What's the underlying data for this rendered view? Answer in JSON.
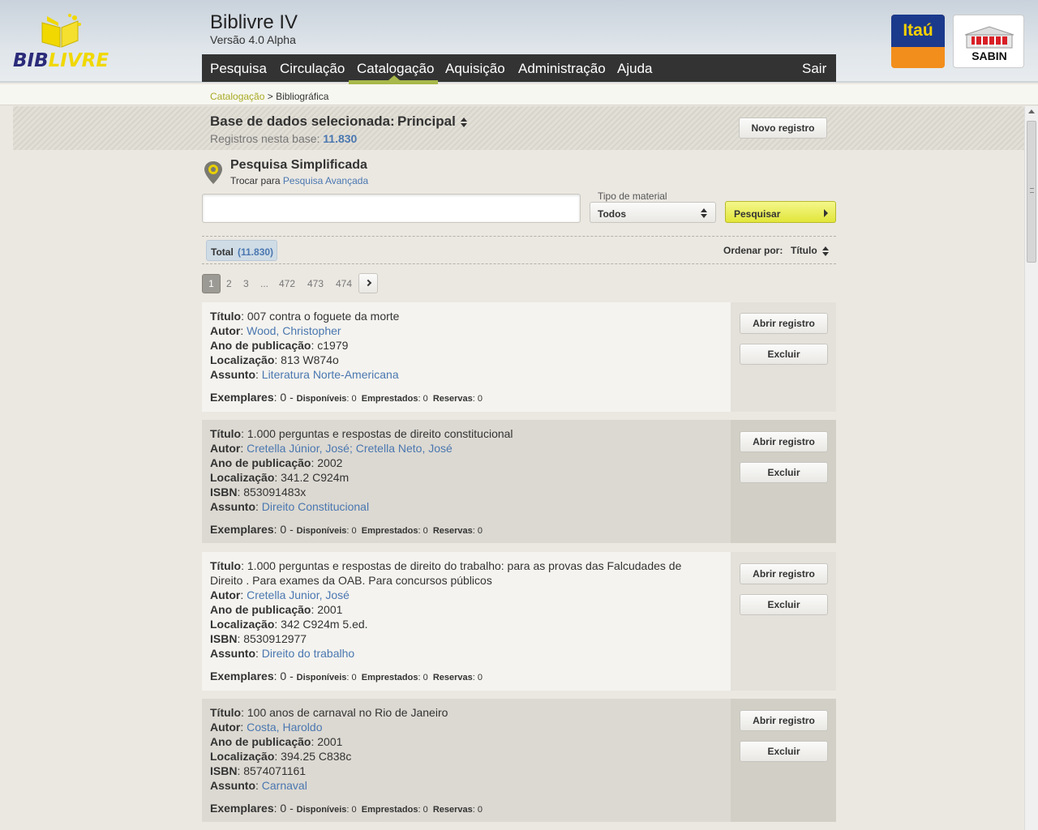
{
  "app": {
    "title": "Biblivre IV",
    "version": "Versão 4.0 Alpha",
    "logo_text_a": "BIB",
    "logo_text_b": "LIVRE"
  },
  "nav": {
    "items": [
      {
        "label": "Pesquisa"
      },
      {
        "label": "Circulação"
      },
      {
        "label": "Catalogação",
        "active": true
      },
      {
        "label": "Aquisição"
      },
      {
        "label": "Administração"
      },
      {
        "label": "Ajuda"
      }
    ],
    "logout": "Sair",
    "accent": "#a8b84a"
  },
  "sponsors": {
    "itau": "Itaú",
    "sabin": "SABIN"
  },
  "breadcrumb": {
    "parent": "Catalogação",
    "separator": " > ",
    "current": "Bibliográfica"
  },
  "database": {
    "label": "Base de dados selecionada:",
    "selected": "Principal",
    "count_label": "Registros nesta base:",
    "count": "11.830",
    "new_record": "Novo registro"
  },
  "search": {
    "title": "Pesquisa Simplificada",
    "switch_prefix": "Trocar para",
    "switch_link": "Pesquisa Avançada",
    "input_value": "",
    "material_label": "Tipo de material",
    "material_value": "Todos",
    "submit": "Pesquisar",
    "submit_color": "#e6ea44"
  },
  "results": {
    "total_label": "Total",
    "total_count": "(11.830)",
    "order_label": "Ordenar por:",
    "order_value": "Título"
  },
  "pagination": {
    "current": "1",
    "pages": [
      "2",
      "3",
      "...",
      "472",
      "473",
      "474"
    ]
  },
  "record_labels": {
    "titulo": "Título",
    "autor": "Autor",
    "ano": "Ano de publicação",
    "localizacao": "Localização",
    "isbn": "ISBN",
    "assunto": "Assunto",
    "exemplares": "Exemplares",
    "disponiveis": "Disponíveis",
    "emprestados": "Emprestados",
    "reservas": "Reservas",
    "open": "Abrir registro",
    "delete": "Excluir"
  },
  "records": [
    {
      "titulo": "007 contra o foguete da morte",
      "autor": "Wood, Christopher",
      "ano": "c1979",
      "localizacao": "813 W874o",
      "assunto": "Literatura Norte-Americana",
      "exemplares": "0",
      "disponiveis": "0",
      "emprestados": "0",
      "reservas": "0"
    },
    {
      "titulo": "1.000 perguntas e respostas de direito constitucional",
      "autor_1": "Cretella Júnior, José",
      "autor_2": "Cretella Neto, José",
      "ano": "2002",
      "localizacao": "341.2 C924m",
      "isbn": "853091483x",
      "assunto": "Direito Constitucional",
      "exemplares": "0",
      "disponiveis": "0",
      "emprestados": "0",
      "reservas": "0"
    },
    {
      "titulo_1": "1.000 perguntas e respostas de direito do trabalho: para as provas das Falcudades de",
      "titulo_2": "Direito . Para exames da OAB. Para concursos públicos",
      "autor": "Cretella Junior, José",
      "ano": "2001",
      "localizacao": "342 C924m 5.ed.",
      "isbn": "8530912977",
      "assunto": "Direito do trabalho",
      "exemplares": "0",
      "disponiveis": "0",
      "emprestados": "0",
      "reservas": "0"
    },
    {
      "titulo": "100 anos de carnaval no Rio de Janeiro",
      "autor": "Costa, Haroldo",
      "ano": "2001",
      "localizacao": "394.25 C838c",
      "isbn": "8574071161",
      "assunto": "Carnaval",
      "exemplares": "0",
      "disponiveis": "0",
      "emprestados": "0",
      "reservas": "0"
    }
  ]
}
